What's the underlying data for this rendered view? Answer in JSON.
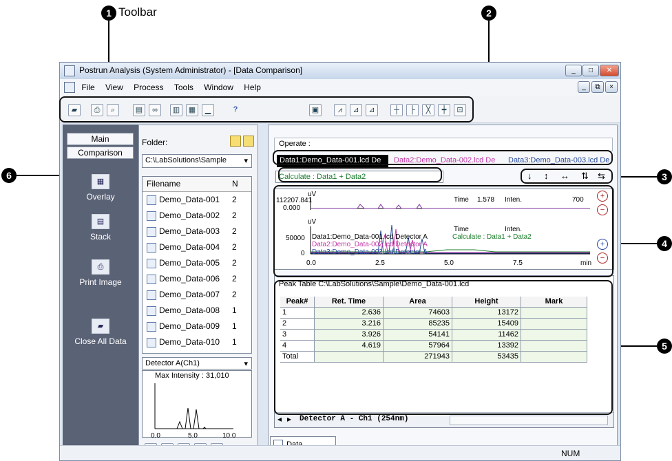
{
  "callouts": {
    "c1": "1",
    "c2": "2",
    "c3": "3",
    "c4": "4",
    "c5": "5",
    "c6": "6",
    "toolbar_label": "Toolbar"
  },
  "window": {
    "title": "Postrun Analysis (System Administrator) - [Data Comparison]",
    "menus": [
      "File",
      "View",
      "Process",
      "Tools",
      "Window",
      "Help"
    ]
  },
  "toolbar": {
    "help": "?"
  },
  "nav": {
    "tab_main": "Main",
    "tab_comparison": "Comparison",
    "items": [
      {
        "label": "Overlay"
      },
      {
        "label": "Stack"
      },
      {
        "label": "Print Image"
      },
      {
        "label": "Close All Data"
      }
    ]
  },
  "file_panel": {
    "folder_label": "Folder:",
    "folder_value": "C:\\LabSolutions\\Sample",
    "col_filename": "Filename",
    "col_n": "N",
    "files": [
      {
        "name": "Demo_Data-001",
        "n": "2"
      },
      {
        "name": "Demo_Data-002",
        "n": "2"
      },
      {
        "name": "Demo_Data-003",
        "n": "2"
      },
      {
        "name": "Demo_Data-004",
        "n": "2"
      },
      {
        "name": "Demo_Data-005",
        "n": "2"
      },
      {
        "name": "Demo_Data-006",
        "n": "2"
      },
      {
        "name": "Demo_Data-007",
        "n": "2"
      },
      {
        "name": "Demo_Data-008",
        "n": "1"
      },
      {
        "name": "Demo_Data-009",
        "n": "1"
      },
      {
        "name": "Demo_Data-010",
        "n": "1"
      }
    ],
    "detector": "Detector A(Ch1)",
    "max_intensity": "Max Intensity : 31,010",
    "mini_axis": [
      "0.0",
      "5.0",
      "10.0"
    ]
  },
  "operate": {
    "label": "Operate :"
  },
  "data_tabs": [
    {
      "label": "Data1:Demo_Data-001.lcd De",
      "color": "#ffffff"
    },
    {
      "label": "Data2:Demo_Data-002.lcd De",
      "color": "#c236a8"
    },
    {
      "label": "Data3:Demo_Data-003.lcd De",
      "color": "#244a9a"
    }
  ],
  "calculate": "Calculate : Data1 + Data2",
  "chrom": {
    "top_ymax": "112207.841",
    "top_ymin": "0.000",
    "top_unit": "uV",
    "time_label": "Time",
    "time_value": "1.578",
    "inten_label": "Inten.",
    "inten_value": "700",
    "bottom_unit": "uV",
    "bottom_ylabel": "50000",
    "bottom_zero": "0",
    "legend_1": "Data1:Demo_Data-001.lcd Detector A",
    "legend_2": "Data2:Demo_Data-002.lcd Detector A",
    "legend_3": "Data3:Demo_Data-003.lcd Detector A",
    "legend_calc": "Calculate : Data1 + Data2",
    "x_ticks": [
      "0.0",
      "2.5",
      "5.0",
      "7.5"
    ],
    "x_unit": "min"
  },
  "peak_table": {
    "title": "Peak Table   C:\\LabSolutions\\Sample\\Demo_Data-001.lcd",
    "headers": [
      "Peak#",
      "Ret. Time",
      "Area",
      "Height",
      "Mark"
    ],
    "rows": [
      [
        "1",
        "2.636",
        "74603",
        "13172",
        ""
      ],
      [
        "2",
        "3.216",
        "85235",
        "15409",
        ""
      ],
      [
        "3",
        "3.926",
        "54141",
        "11462",
        ""
      ],
      [
        "4",
        "4.619",
        "57964",
        "13392",
        ""
      ],
      [
        "Total",
        "",
        "271943",
        "53435",
        ""
      ]
    ],
    "tab": "Detector A - Ch1 (254nm)"
  },
  "doc_tab": "Data Compar...",
  "status": {
    "num": "NUM"
  }
}
